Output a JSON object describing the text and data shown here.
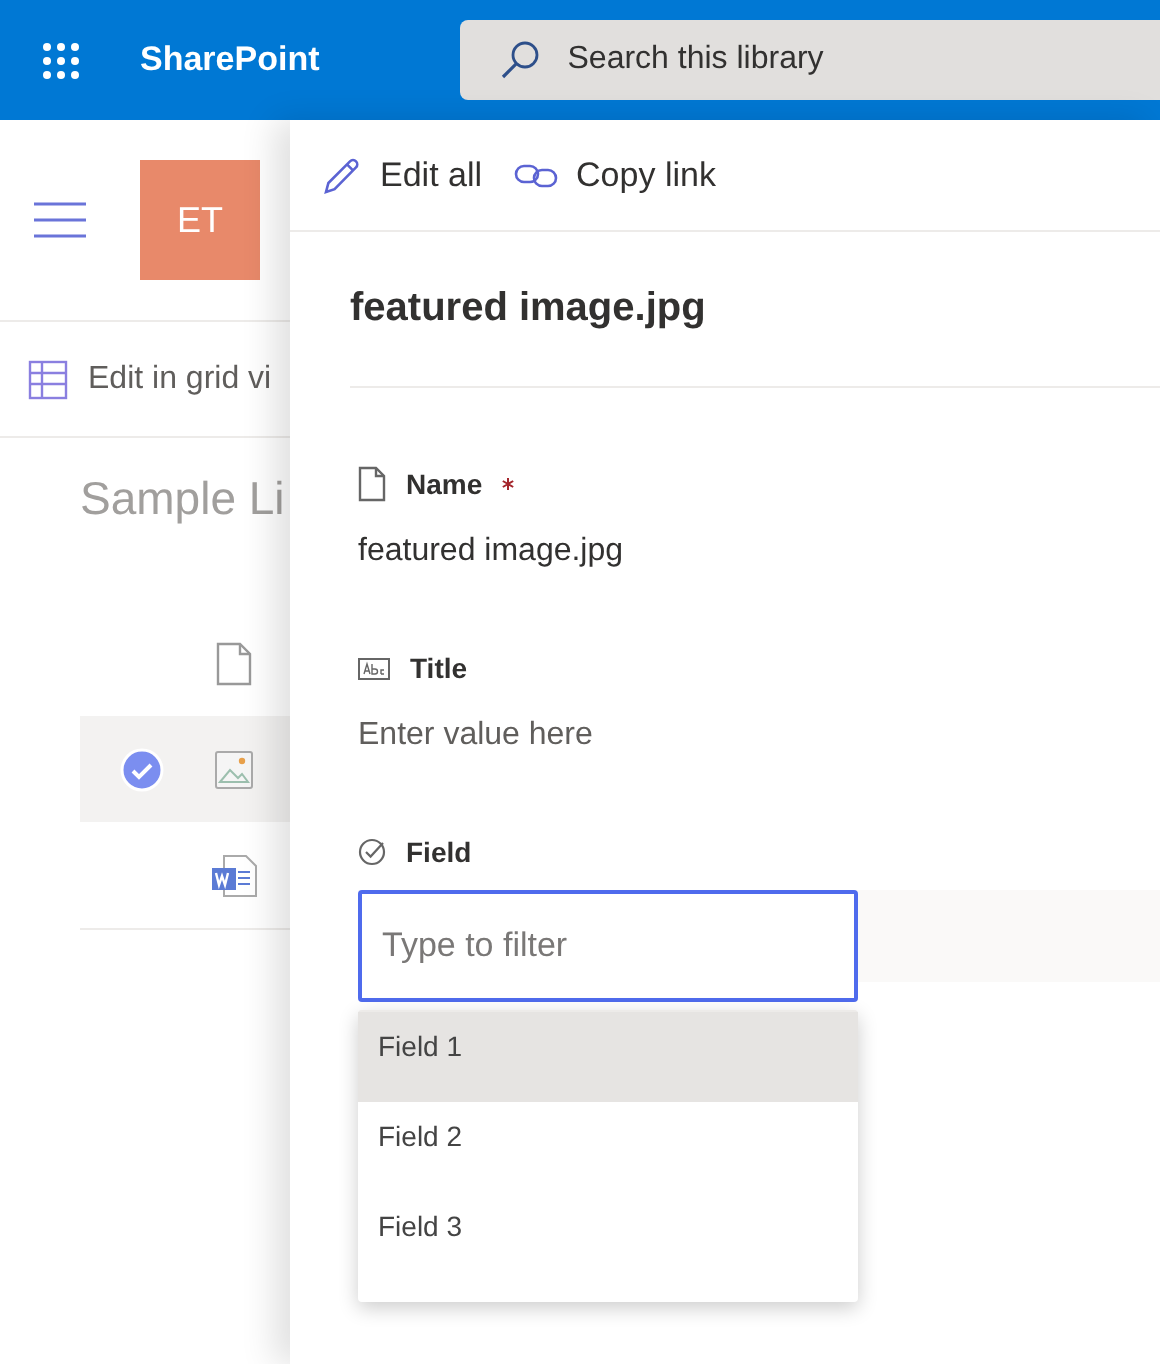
{
  "header": {
    "app_name": "SharePoint",
    "search": {
      "placeholder": "Search this library"
    }
  },
  "site": {
    "initials": "ET",
    "command": "Edit in grid vi",
    "library_title": "Sample Li",
    "rows": [
      {
        "kind": "file",
        "selected": false
      },
      {
        "kind": "image",
        "selected": true
      },
      {
        "kind": "word",
        "selected": false
      }
    ]
  },
  "panel": {
    "actions": [
      {
        "kind": "edit",
        "label": "Edit all"
      },
      {
        "kind": "link",
        "label": "Copy link"
      }
    ],
    "title": "featured image.jpg",
    "fields": [
      {
        "kind": "file",
        "label": "Name",
        "required": true,
        "value": "featured image.jpg"
      },
      {
        "kind": "text",
        "label": "Title",
        "required": false,
        "placeholder": "Enter value here"
      },
      {
        "kind": "choice",
        "label": "Field",
        "required": false,
        "filter_placeholder": "Type to filter",
        "options": [
          {
            "label": "Field 1",
            "highlighted": true
          },
          {
            "label": "Field 2",
            "highlighted": false
          },
          {
            "label": "Field 3",
            "highlighted": false
          }
        ]
      }
    ]
  }
}
